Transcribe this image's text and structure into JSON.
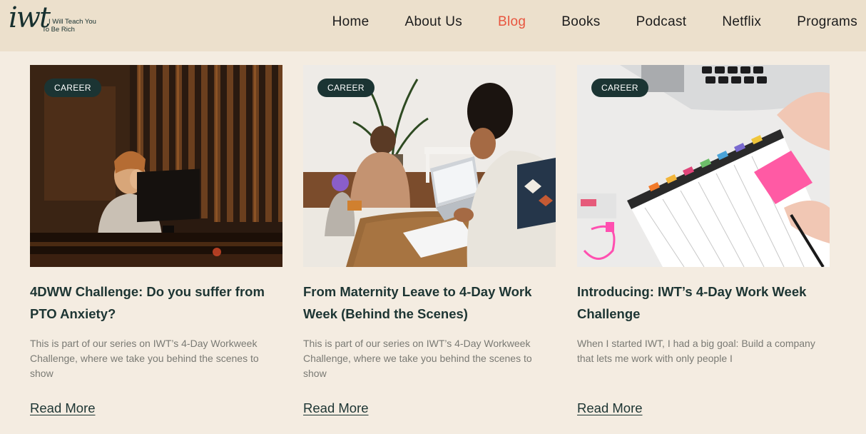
{
  "brand": {
    "logo_mark": "iwt",
    "tagline_line1": "I Will Teach You",
    "tagline_line2": "To Be Rich"
  },
  "nav": {
    "items": [
      {
        "label": "Home",
        "active": false
      },
      {
        "label": "About Us",
        "active": false
      },
      {
        "label": "Blog",
        "active": true
      },
      {
        "label": "Books",
        "active": false
      },
      {
        "label": "Podcast",
        "active": false
      },
      {
        "label": "Netflix",
        "active": false
      },
      {
        "label": "Programs",
        "active": false
      }
    ]
  },
  "posts": [
    {
      "category": "CAREER",
      "title": "4DWW Challenge: Do you suffer from PTO Anxiety?",
      "excerpt": "This is part of our series on IWT’s 4-Day Workweek Challenge, where we take you behind the scenes to show",
      "read_more": "Read More",
      "image": "woman-stressed-at-computer-photo"
    },
    {
      "category": "CAREER",
      "title": "From Maternity Leave to 4-Day Work Week (Behind the Scenes)",
      "excerpt": "This is part of our series on IWT’s 4-Day Workweek Challenge, where we take you behind the scenes to show",
      "read_more": "Read More",
      "image": "family-working-from-home-photo"
    },
    {
      "category": "CAREER",
      "title": "Introducing: IWT’s 4-Day Work Week Challenge",
      "excerpt": "When I started IWT, I had a big goal: Build a company that lets me work with only people I",
      "read_more": "Read More",
      "image": "planner-and-laptop-photo"
    }
  ],
  "colors": {
    "page_bg": "#f4ece1",
    "header_bg": "#ece0cc",
    "accent_active": "#e8553e",
    "badge_bg": "#1b3433",
    "text_dark": "#1d3533",
    "text_muted": "#7a7a74"
  }
}
